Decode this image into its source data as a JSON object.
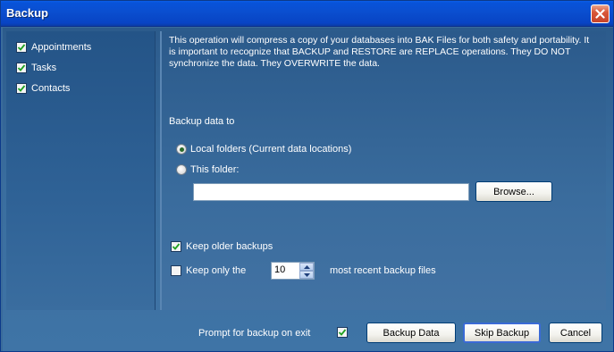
{
  "window": {
    "title": "Backup"
  },
  "sidebar": {
    "items": [
      {
        "label": "Appointments",
        "checked": true
      },
      {
        "label": "Tasks",
        "checked": true
      },
      {
        "label": "Contacts",
        "checked": true
      }
    ]
  },
  "main": {
    "description": "This operation will compress a copy of your databases into BAK Files for both safety and portability.  It is important to recognize that BACKUP and RESTORE are REPLACE operations.  They DO NOT synchronize the data.  They OVERWRITE the data.",
    "backup_to_label": "Backup data to",
    "radio_local_label": "Local folders (Current data locations)",
    "radio_folder_label": "This folder:",
    "selected_radio": "local",
    "folder_value": "",
    "browse_label": "Browse...",
    "keep_older_label": "Keep older backups",
    "keep_older_checked": true,
    "keep_only_label": "Keep only the",
    "keep_only_checked": false,
    "keep_count": "10",
    "recent_label": "most recent backup files"
  },
  "footer": {
    "prompt_label": "Prompt for backup on exit",
    "prompt_checked": true,
    "backup_button": "Backup Data",
    "skip_button": "Skip Backup",
    "cancel_button": "Cancel"
  },
  "colors": {
    "titlebar": "#0a4fd0",
    "panel": "#3a6b9b",
    "close_button": "#d9583a"
  }
}
